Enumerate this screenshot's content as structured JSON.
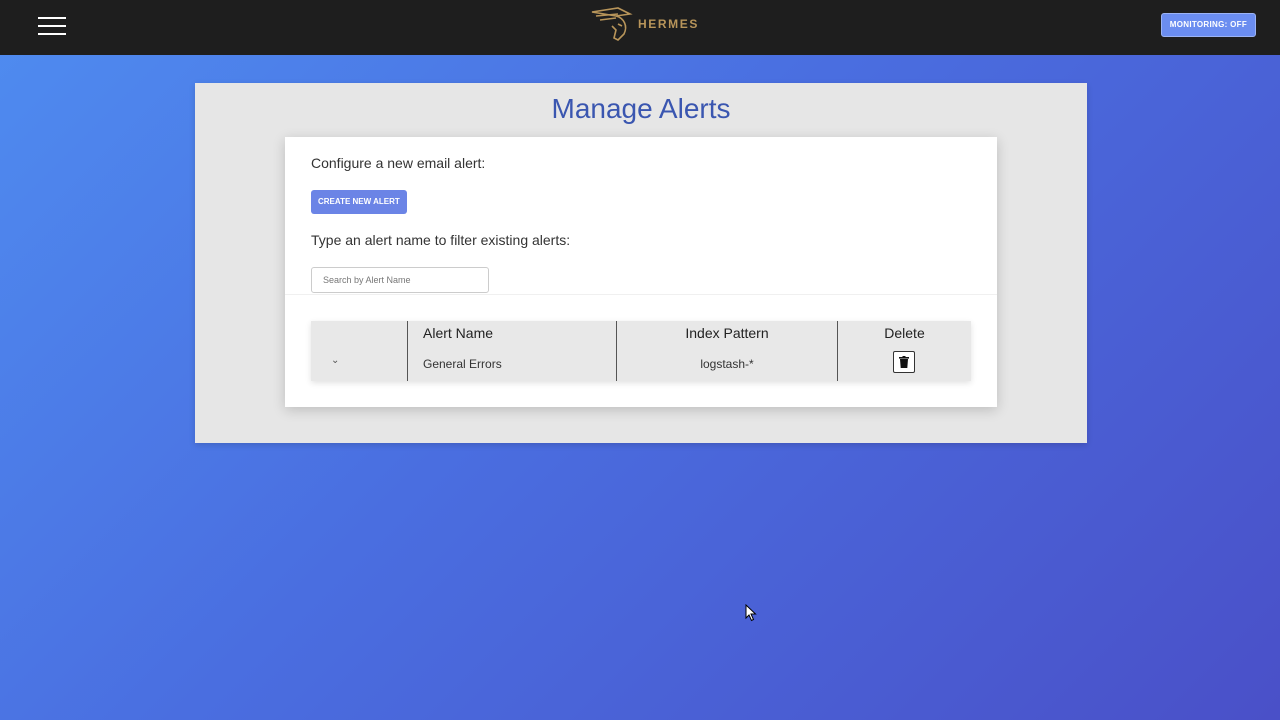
{
  "header": {
    "brand": "HERMES",
    "monitoring_label": "MONITORING: OFF"
  },
  "page": {
    "title": "Manage Alerts",
    "configure_label": "Configure a new email alert:",
    "create_button": "CREATE NEW ALERT",
    "filter_label": "Type an alert name to filter existing alerts:",
    "search_placeholder": "Search by Alert Name"
  },
  "table": {
    "columns": [
      "Alert Name",
      "Index Pattern",
      "Delete"
    ],
    "rows": [
      {
        "alert_name": "General Errors",
        "index_pattern": "logstash-*"
      }
    ]
  },
  "icons": {
    "menu": "hamburger-menu-icon",
    "logo": "hermes-helmet-logo",
    "expand": "chevron-down-icon",
    "delete": "trash-icon",
    "cursor": "mouse-pointer-icon"
  },
  "colors": {
    "topbar": "#1e1e1e",
    "title": "#3a56b0",
    "accent_button": "#6b84e6",
    "brand_gold": "#b8955a"
  }
}
